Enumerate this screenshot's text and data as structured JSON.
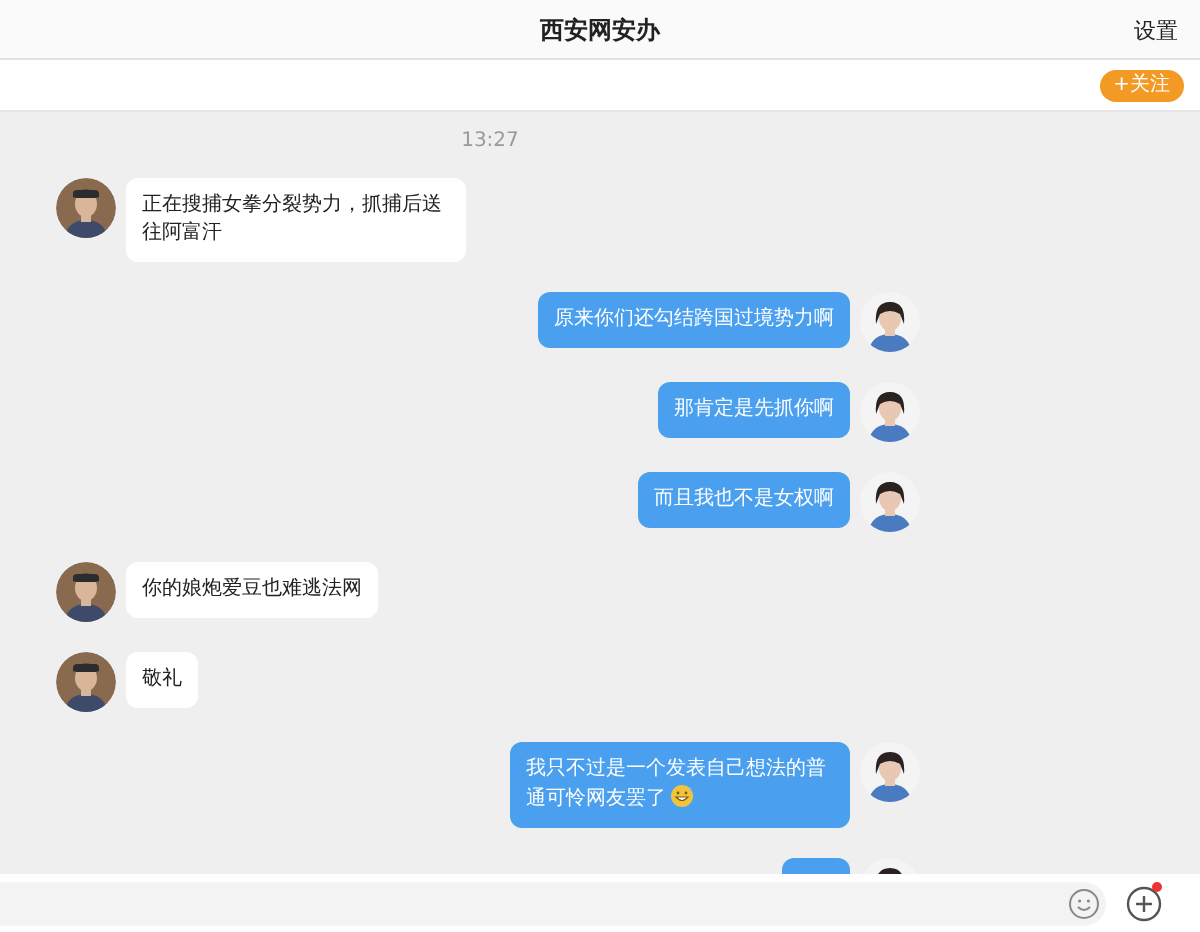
{
  "header": {
    "title": "西安网安办",
    "settings": "设置",
    "follow_button": "+关注"
  },
  "chat": {
    "timestamp": "13:27",
    "messages": [
      {
        "sent": false,
        "kind": "text",
        "text": "正在搜捕女拳分裂势力，抓捕后送往阿富汗"
      },
      {
        "sent": true,
        "kind": "text",
        "text": "原来你们还勾结跨国过境势力啊"
      },
      {
        "sent": true,
        "kind": "text",
        "text": "那肯定是先抓你啊"
      },
      {
        "sent": true,
        "kind": "text",
        "text": "而且我也不是女权啊"
      },
      {
        "sent": false,
        "kind": "text",
        "text": "你的娘炮爱豆也难逃法网"
      },
      {
        "sent": false,
        "kind": "text",
        "text": "敬礼"
      },
      {
        "sent": true,
        "kind": "text",
        "text": "我只不过是一个发表自己想法的普通可怜网友罢了",
        "trailing_emoji": true
      },
      {
        "sent": true,
        "kind": "cut_off"
      }
    ]
  },
  "input_bar": {
    "plus_badge": true
  }
}
